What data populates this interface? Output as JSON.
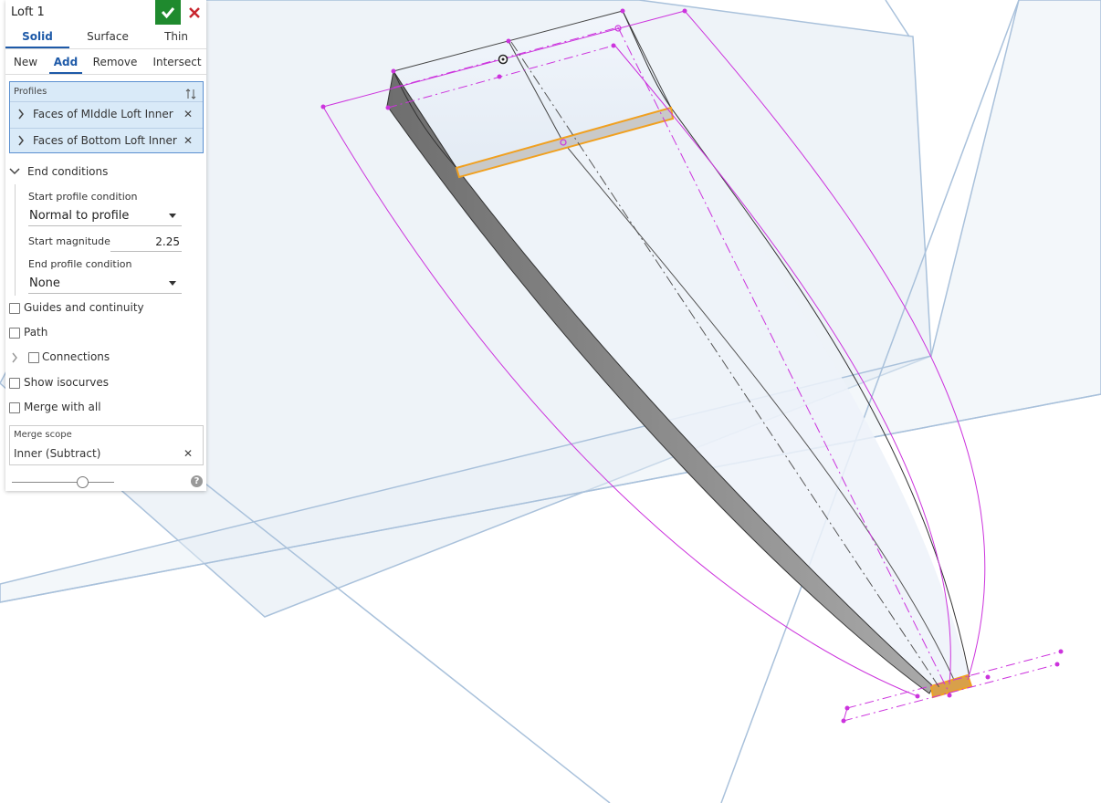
{
  "feature": {
    "title": "Loft 1"
  },
  "body_type_tabs": [
    {
      "label": "Solid",
      "active": true
    },
    {
      "label": "Surface",
      "active": false
    },
    {
      "label": "Thin",
      "active": false
    }
  ],
  "operation_tabs": [
    {
      "label": "New",
      "active": false
    },
    {
      "label": "Add",
      "active": true
    },
    {
      "label": "Remove",
      "active": false
    },
    {
      "label": "Intersect",
      "active": false
    }
  ],
  "profiles": {
    "label": "Profiles",
    "items": [
      {
        "label": "Faces of MIddle Loft Inner"
      },
      {
        "label": "Faces of Bottom Loft Inner"
      }
    ]
  },
  "end_conditions": {
    "label": "End conditions",
    "expanded": true,
    "start_profile_condition_label": "Start profile condition",
    "start_profile_condition_value": "Normal to profile",
    "start_magnitude_label": "Start magnitude",
    "start_magnitude_value": "2.25",
    "end_profile_condition_label": "End profile condition",
    "end_profile_condition_value": "None"
  },
  "options": {
    "guides_label": "Guides and continuity",
    "path_label": "Path",
    "connections_label": "Connections",
    "isocurves_label": "Show isocurves",
    "merge_all_label": "Merge with all"
  },
  "merge_scope": {
    "label": "Merge scope",
    "value": "Inner (Subtract)"
  },
  "colors": {
    "accept_green": "#1f8a2e",
    "cancel_red": "#c8262e",
    "selection_blue": "#d9eaf8",
    "sketch_magenta": "#cc33dd",
    "highlight_orange": "#f0a020",
    "plane_fill": "#e8eff6"
  }
}
